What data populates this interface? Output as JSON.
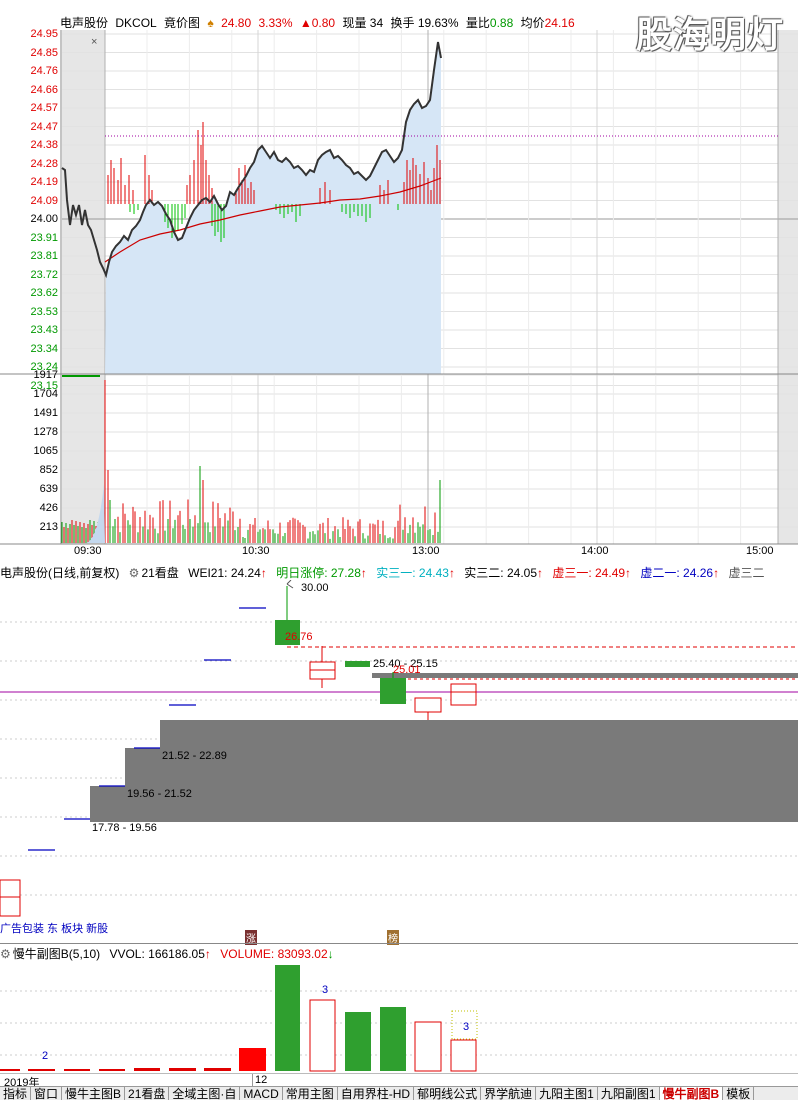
{
  "header": {
    "name": "电声股份",
    "code": "DKCOL",
    "mode": "竟价图",
    "price": "24.80",
    "pct": "3.33%",
    "change": "▲0.80",
    "current_volume": "现量 34",
    "turnover": "换手 19.63%",
    "volume_ratio_label": "量比",
    "volume_ratio": "0.88",
    "avg_price_label": "均价",
    "avg_price": "24.16",
    "close_marker": "×"
  },
  "watermark": "股海明灯",
  "price_scale": [
    "24.95",
    "24.85",
    "24.76",
    "24.66",
    "24.57",
    "24.47",
    "24.38",
    "24.28",
    "24.19",
    "24.09",
    "24.00",
    "23.91",
    "23.81",
    "23.72",
    "23.62",
    "23.53",
    "23.43",
    "23.34",
    "23.24",
    "23.15"
  ],
  "volume_scale": [
    "1917",
    "1704",
    "1491",
    "1278",
    "1065",
    "852",
    "639",
    "426",
    "213"
  ],
  "time_axis": [
    "09:30",
    "10:30",
    "13:00",
    "14:00",
    "15:00"
  ],
  "kline_header": {
    "name": "电声股份(日线,前复权)",
    "indicator": "21看盘",
    "wei21": "WEI21: 24.24",
    "zhangting": "明日涨停: 27.28",
    "shi31": "实三一: 24.43",
    "shi32": "实三二: 24.05",
    "xu31": "虚三一: 24.49",
    "xu21": "虚二一: 24.26",
    "xu32": "虚三二"
  },
  "kline_labels": {
    "high": "30.00",
    "k1": "26.76",
    "range_a": "25.40 - 25.15",
    "k2": "25.01",
    "zone1": "21.52 - 22.89",
    "zone2": "19.56 - 21.52",
    "zone3": "17.78 - 19.56"
  },
  "news_text": "广告包装 东 板块 新股",
  "badges": {
    "zhang": "涨",
    "bang": "榜"
  },
  "sub_header": {
    "name": "慢牛副图B(5,10)",
    "vvol": "VVOL: 166186.05",
    "volume": "VOLUME: 83093.02"
  },
  "sub_labels": {
    "n1": "2",
    "n2": "3",
    "n3": "3"
  },
  "year_bar": {
    "year": "2019年",
    "month": "12"
  },
  "tabs": [
    "指标",
    "窗口",
    "慢牛主图B",
    "21看盘",
    "全域主图·自",
    "MACD",
    "常用主图",
    "自用界柱-HD",
    "郁明线公式",
    "界学航迪",
    "九阳主图1",
    "九阳副图1",
    "慢牛副图B",
    "模板"
  ],
  "active_tab": 12,
  "colors": {
    "up": "#e00000",
    "down": "#009900",
    "price_line": "#333333",
    "avg_line": "#cc0000",
    "fill": "#d6e6f6"
  }
}
